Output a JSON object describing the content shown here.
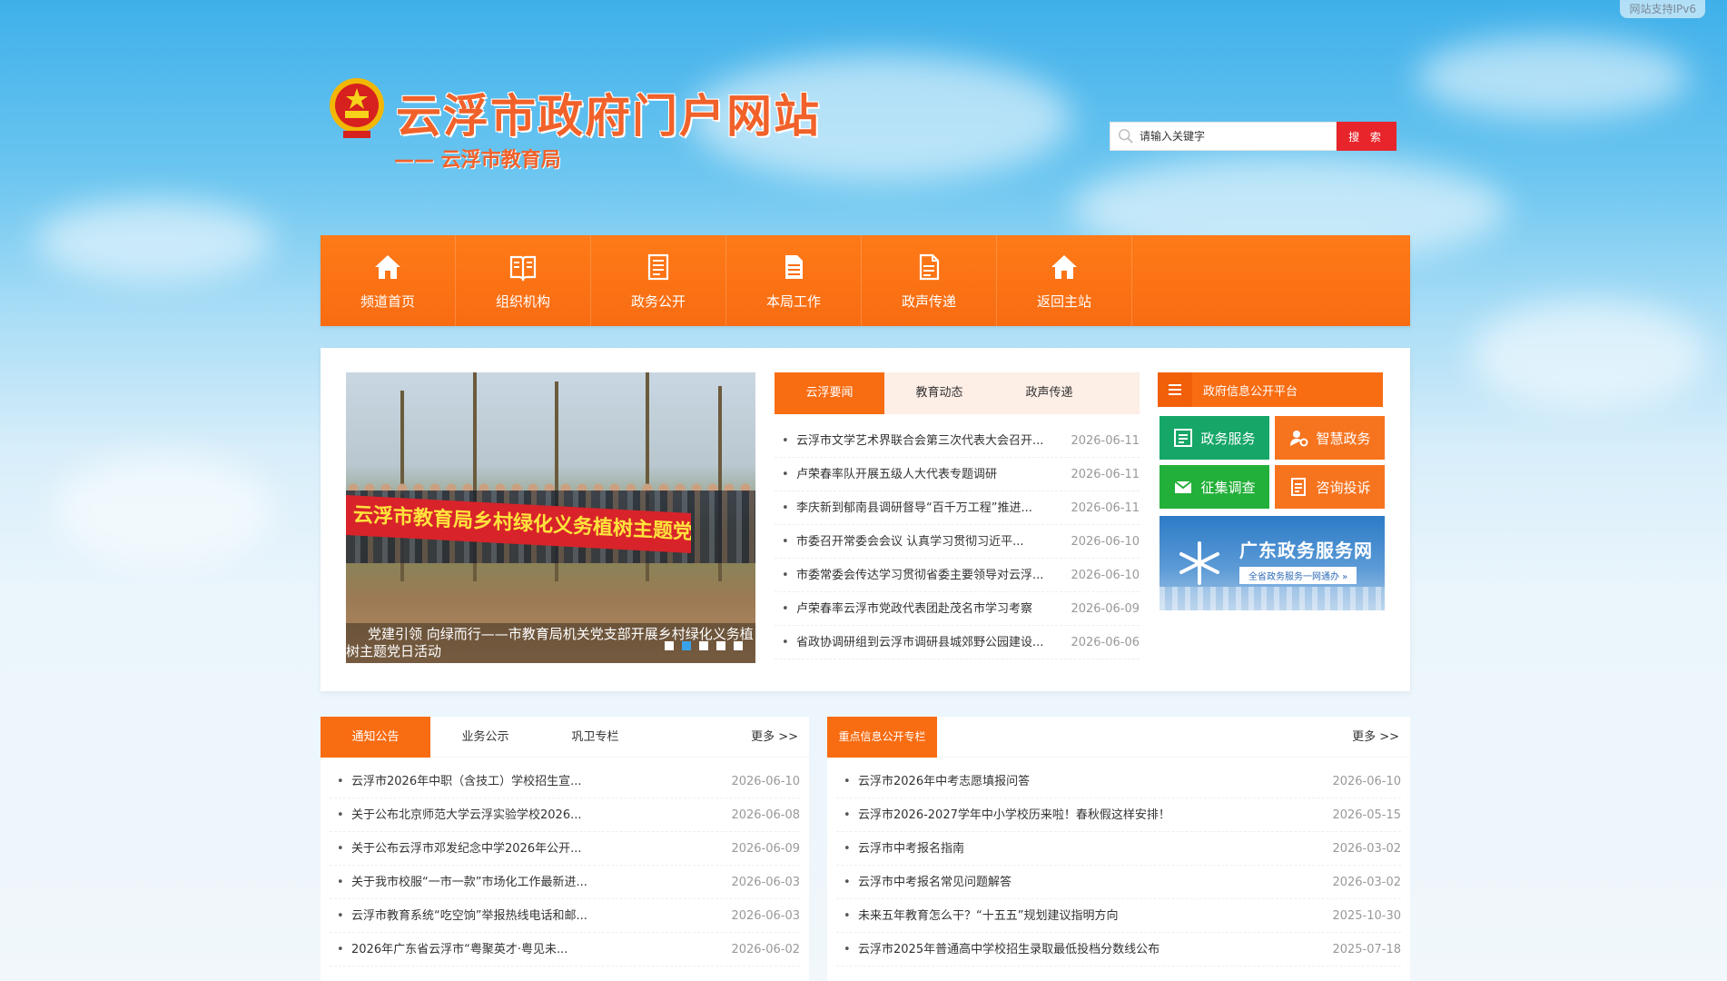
{
  "ipv6_badge": "网站支持IPv6",
  "header": {
    "site_title": "云浮市政府门户网站",
    "site_subtitle": "—— 云浮市教育局",
    "search_placeholder": "请输入关键字",
    "search_button": "搜 索"
  },
  "nav": [
    {
      "label": "频道首页",
      "icon": "home-icon"
    },
    {
      "label": "组织机构",
      "icon": "book-icon"
    },
    {
      "label": "政务公开",
      "icon": "document-icon"
    },
    {
      "label": "本局工作",
      "icon": "file-icon"
    },
    {
      "label": "政声传递",
      "icon": "file-icon"
    },
    {
      "label": "返回主站",
      "icon": "home-icon"
    }
  ],
  "slider": {
    "banner_text": "云浮市教育局乡村绿化义务植树主题党日活动",
    "caption": "党建引领 向绿而行——市教育局机关党支部开展乡村绿化义务植树主题党日活动",
    "active_dot": 2
  },
  "news": {
    "tabs": [
      "云浮要闻",
      "教育动态",
      "政声传递"
    ],
    "items": [
      {
        "title": "云浮市文学艺术界联合会第三次代表大会召开...",
        "date": "2026-06-11"
      },
      {
        "title": "卢荣春率队开展五级人大代表专题调研",
        "date": "2026-06-11"
      },
      {
        "title": "李庆新到郁南县调研督导“百千万工程”推进...",
        "date": "2026-06-11"
      },
      {
        "title": "市委召开常委会会议 认真学习贯彻习近平...",
        "date": "2026-06-10"
      },
      {
        "title": "市委常委会传达学习贯彻省委主要领导对云浮...",
        "date": "2026-06-10"
      },
      {
        "title": "卢荣春率云浮市党政代表团赴茂名市学习考察",
        "date": "2026-06-09"
      },
      {
        "title": "省政协调研组到云浮市调研县城郊野公园建设...",
        "date": "2026-06-06"
      }
    ]
  },
  "info_platform": {
    "title": "政府信息公开平台",
    "services": [
      "政务服务",
      "智慧政务",
      "征集调查",
      "咨询投诉"
    ],
    "banner_title": "广东政务服务网",
    "banner_sub": "全省政务服务一网通办 »"
  },
  "notices": {
    "tabs": [
      "通知公告",
      "业务公示",
      "巩卫专栏"
    ],
    "more": "更多 >>",
    "items": [
      {
        "title": "云浮市2026年中职（含技工）学校招生宣...",
        "date": "2026-06-10"
      },
      {
        "title": "关于公布北京师范大学云浮实验学校2026...",
        "date": "2026-06-08"
      },
      {
        "title": "关于公布云浮市邓发纪念中学2026年公开...",
        "date": "2026-06-09"
      },
      {
        "title": "关于我市校服“一市一款”市场化工作最新进...",
        "date": "2026-06-03"
      },
      {
        "title": "云浮市教育系统“吃空饷”举报热线电话和邮...",
        "date": "2026-06-03"
      },
      {
        "title": "2026年广东省云浮市“粤聚英才·粤见未...",
        "date": "2026-06-02"
      }
    ]
  },
  "key_info": {
    "tab": "重点信息公开专栏",
    "more": "更多 >>",
    "items": [
      {
        "title": "云浮市2026年中考志愿填报问答",
        "date": "2026-06-10"
      },
      {
        "title": "云浮市2026-2027学年中小学校历来啦！春秋假这样安排！",
        "date": "2026-05-15"
      },
      {
        "title": "云浮市中考报名指南",
        "date": "2026-03-02"
      },
      {
        "title": "云浮市中考报名常见问题解答",
        "date": "2026-03-02"
      },
      {
        "title": "未来五年教育怎么干？“十五五”规划建议指明方向",
        "date": "2025-10-30"
      },
      {
        "title": "云浮市2025年普通高中学校招生录取最低投档分数线公布",
        "date": "2025-07-18"
      }
    ]
  },
  "colors": {
    "brand_orange": "#f86c12",
    "title_orange": "#f1612a",
    "search_red": "#e8252b",
    "service_green": "#16a668",
    "dot_active": "#3aa3e8"
  }
}
